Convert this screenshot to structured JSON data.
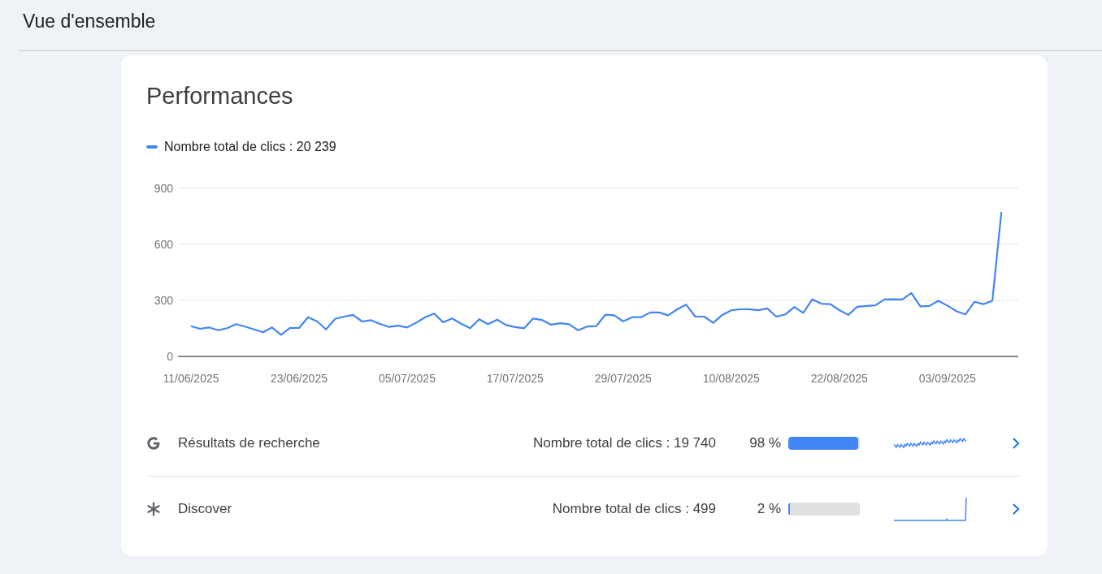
{
  "header": {
    "title": "Vue d'ensemble"
  },
  "card": {
    "title": "Performances",
    "legend": {
      "label": "Nombre total de clics : 20 239"
    },
    "chart_data": {
      "type": "line",
      "ylim": [
        0,
        900
      ],
      "yticks": [
        0,
        300,
        600,
        900
      ],
      "categories": [
        "11/06/2025",
        null,
        null,
        null,
        null,
        null,
        null,
        null,
        null,
        null,
        null,
        null,
        "23/06/2025",
        null,
        null,
        null,
        null,
        null,
        null,
        null,
        null,
        null,
        null,
        null,
        "05/07/2025",
        null,
        null,
        null,
        null,
        null,
        null,
        null,
        null,
        null,
        null,
        null,
        "17/07/2025",
        null,
        null,
        null,
        null,
        null,
        null,
        null,
        null,
        null,
        null,
        null,
        "29/07/2025",
        null,
        null,
        null,
        null,
        null,
        null,
        null,
        null,
        null,
        null,
        null,
        "10/08/2025",
        null,
        null,
        null,
        null,
        null,
        null,
        null,
        null,
        null,
        null,
        null,
        "22/08/2025",
        null,
        null,
        null,
        null,
        null,
        null,
        null,
        null,
        null,
        null,
        null,
        "03/09/2025",
        null,
        null,
        null,
        null,
        null,
        null
      ],
      "series": [
        {
          "color": "#4285f4",
          "values": [
            162,
            148,
            155,
            140,
            151,
            173,
            160,
            145,
            129,
            155,
            116,
            153,
            152,
            210,
            188,
            145,
            201,
            213,
            222,
            187,
            194,
            174,
            158,
            165,
            155,
            180,
            210,
            229,
            183,
            203,
            175,
            151,
            199,
            173,
            197,
            168,
            157,
            151,
            203,
            195,
            170,
            178,
            172,
            140,
            160,
            162,
            223,
            220,
            188,
            210,
            210,
            235,
            235,
            220,
            252,
            277,
            213,
            213,
            180,
            222,
            247,
            252,
            253,
            247,
            257,
            213,
            225,
            265,
            233,
            305,
            282,
            280,
            248,
            222,
            266,
            270,
            273,
            305,
            306,
            305,
            340,
            268,
            270,
            298,
            272,
            242,
            225,
            292,
            280,
            298,
            773
          ]
        }
      ]
    },
    "rows": [
      {
        "kind": "search",
        "label": "Résultats de recherche",
        "clicks": "Nombre total de clics : 19 740",
        "percent": "98 %",
        "level": 0.98
      },
      {
        "kind": "discover",
        "label": "Discover",
        "clicks": "Nombre total de clics : 499",
        "percent": "2 %",
        "level": 0.02
      }
    ]
  }
}
